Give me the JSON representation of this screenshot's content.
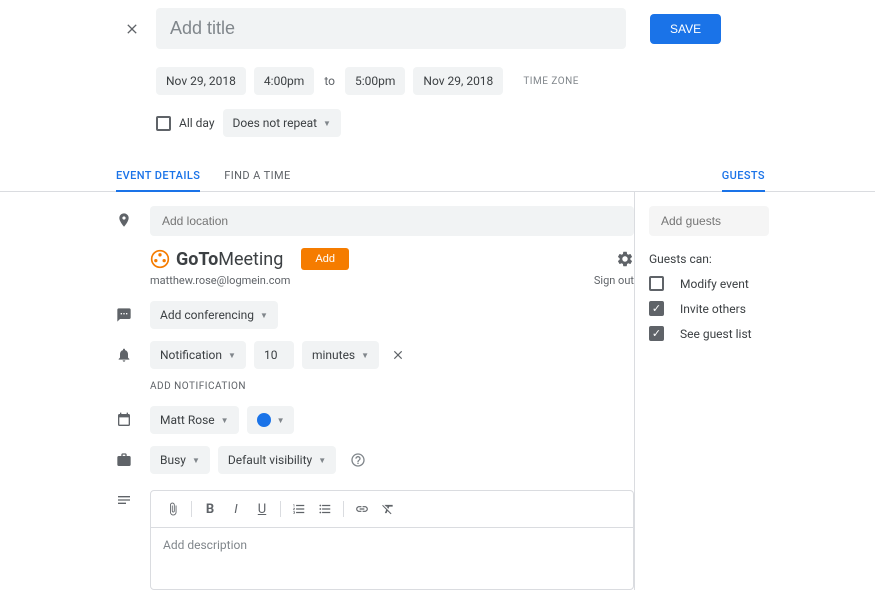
{
  "header": {
    "title_placeholder": "Add title",
    "save_label": "SAVE"
  },
  "datetime": {
    "start_date": "Nov 29, 2018",
    "start_time": "4:00pm",
    "to_label": "to",
    "end_time": "5:00pm",
    "end_date": "Nov 29, 2018",
    "timezone_label": "TIME ZONE"
  },
  "allday": {
    "label": "All day",
    "repeat_label": "Does not repeat"
  },
  "tabs": {
    "event_details": "EVENT DETAILS",
    "find_time": "FIND A TIME",
    "guests": "GUESTS"
  },
  "location": {
    "placeholder": "Add location"
  },
  "gotomeeting": {
    "brand_prefix": "GoTo",
    "brand_suffix": "Meeting",
    "add_label": "Add",
    "email": "matthew.rose@logmein.com",
    "signout_label": "Sign out"
  },
  "conferencing": {
    "label": "Add conferencing"
  },
  "notification": {
    "type_label": "Notification",
    "value": "10",
    "unit_label": "minutes",
    "add_label": "ADD NOTIFICATION"
  },
  "calendar": {
    "owner": "Matt Rose"
  },
  "availability": {
    "busy_label": "Busy",
    "visibility_label": "Default visibility"
  },
  "description": {
    "placeholder": "Add description"
  },
  "guests_panel": {
    "add_placeholder": "Add guests",
    "can_label": "Guests can:",
    "modify_label": "Modify event",
    "invite_label": "Invite others",
    "seelist_label": "See guest list"
  }
}
